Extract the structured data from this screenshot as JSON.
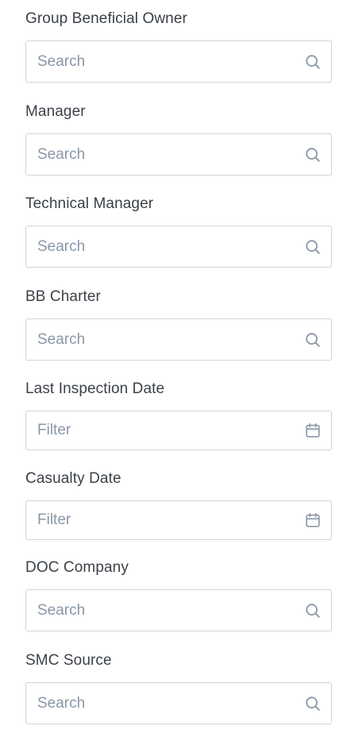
{
  "filters": [
    {
      "label": "Group Beneficial Owner",
      "placeholder": "Search",
      "icon": "search-icon"
    },
    {
      "label": "Manager",
      "placeholder": "Search",
      "icon": "search-icon"
    },
    {
      "label": "Technical Manager",
      "placeholder": "Search",
      "icon": "search-icon"
    },
    {
      "label": "BB Charter",
      "placeholder": "Search",
      "icon": "search-icon"
    },
    {
      "label": "Last Inspection Date",
      "placeholder": "Filter",
      "icon": "calendar-icon"
    },
    {
      "label": "Casualty Date",
      "placeholder": "Filter",
      "icon": "calendar-icon"
    },
    {
      "label": "DOC Company",
      "placeholder": "Search",
      "icon": "search-icon"
    },
    {
      "label": "SMC Source",
      "placeholder": "Search",
      "icon": "search-icon"
    }
  ],
  "colors": {
    "label_text": "#3b4148",
    "placeholder_text": "#8a97a8",
    "input_border": "#cfd4da",
    "icon": "#8a97a8"
  }
}
